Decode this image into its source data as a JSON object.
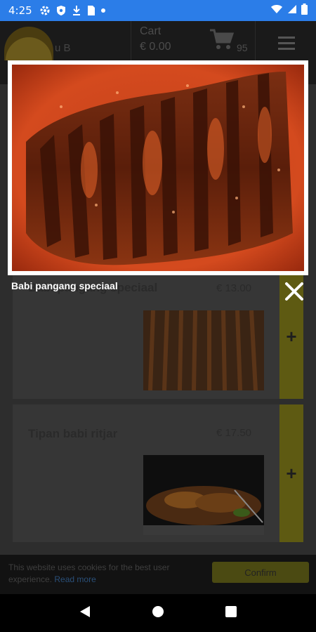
{
  "status_bar": {
    "time": "4:25",
    "icons": [
      "settings-icon",
      "shield-icon",
      "download-icon",
      "sim-icon",
      "dot-icon",
      "wifi-icon",
      "signal-icon",
      "battery-icon"
    ]
  },
  "header": {
    "cart_label": "Cart",
    "cart_amount": "€ 0.00",
    "cart_total_partial": "95",
    "logo_partial": "u B"
  },
  "menu_items": [
    {
      "name": "Babi pangang speciaal",
      "price": "€ 13.00",
      "add_label": "+"
    },
    {
      "name": "Tipan babi ritjar",
      "price": "€ 17.50",
      "add_label": "+"
    }
  ],
  "cookie": {
    "text": "This website uses cookies for the best user experience.",
    "link": "Read more",
    "confirm": "Confirm"
  },
  "lightbox": {
    "caption": "Babi pangang speciaal",
    "close_icon": "close-icon"
  },
  "colors": {
    "status_bar": "#2b7de8",
    "accent_dimmed": "#5e5a12",
    "overlay": "#1d1d1d"
  }
}
